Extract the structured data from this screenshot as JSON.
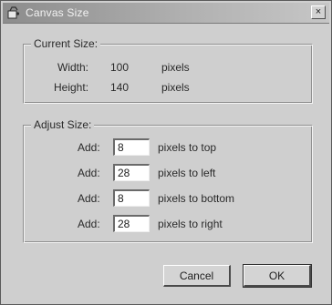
{
  "window": {
    "title": "Canvas Size",
    "app_icon": "paint-icon",
    "close_glyph": "×"
  },
  "current_size": {
    "label": "Current Size:",
    "width_label": "Width:",
    "width_value": "100",
    "width_unit": "pixels",
    "height_label": "Height:",
    "height_value": "140",
    "height_unit": "pixels"
  },
  "adjust_size": {
    "label": "Adjust Size:",
    "rows": [
      {
        "add_label": "Add:",
        "value": "8",
        "suffix": "pixels to top"
      },
      {
        "add_label": "Add:",
        "value": "28",
        "suffix": "pixels to left"
      },
      {
        "add_label": "Add:",
        "value": "8",
        "suffix": "pixels to bottom"
      },
      {
        "add_label": "Add:",
        "value": "28",
        "suffix": "pixels to right"
      }
    ]
  },
  "buttons": {
    "cancel_label": "Cancel",
    "ok_label": "OK"
  }
}
